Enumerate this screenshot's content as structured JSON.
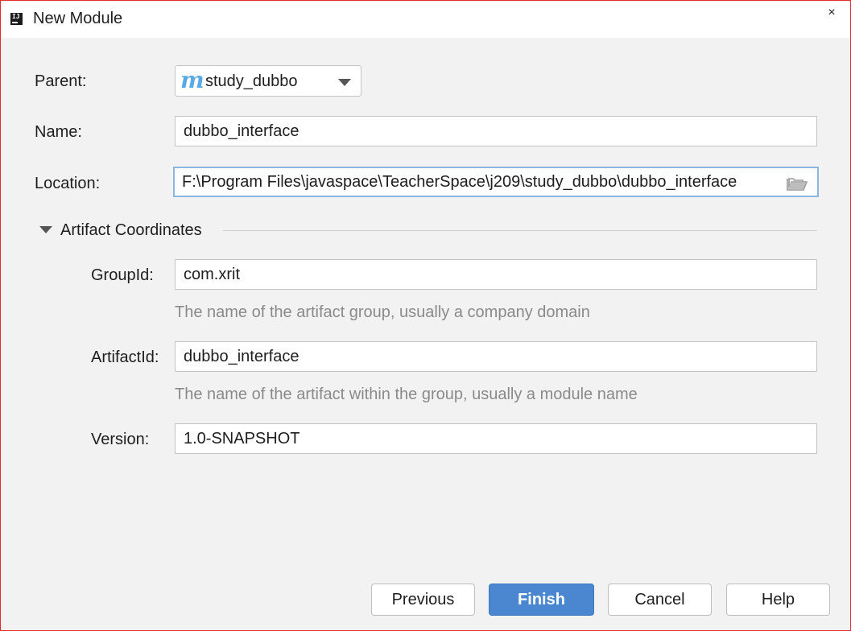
{
  "window": {
    "title": "New Module",
    "app_icon_text": "IJ",
    "close_glyph": "×"
  },
  "form": {
    "parent": {
      "label": "Parent:",
      "value": "study_dubbo",
      "icon": "maven-module-icon"
    },
    "name": {
      "label": "Name:",
      "value": "dubbo_interface"
    },
    "location": {
      "label": "Location:",
      "value": "F:\\Program Files\\javaspace\\TeacherSpace\\j209\\study_dubbo\\dubbo_interface",
      "icon": "folder-icon"
    }
  },
  "artifact": {
    "section_title": "Artifact Coordinates",
    "group_id": {
      "label": "GroupId:",
      "value": "com.xrit",
      "hint": "The name of the artifact group, usually a company domain"
    },
    "artifact_id": {
      "label": "ArtifactId:",
      "value": "dubbo_interface",
      "hint": "The name of the artifact within the group, usually a module name"
    },
    "version": {
      "label": "Version:",
      "value": "1.0-SNAPSHOT"
    }
  },
  "buttons": {
    "previous": "Previous",
    "finish": "Finish",
    "cancel": "Cancel",
    "help": "Help"
  },
  "colors": {
    "accent": "#4a87d0",
    "focus_border": "#8cb5e4",
    "window_border": "#e32b2b"
  }
}
